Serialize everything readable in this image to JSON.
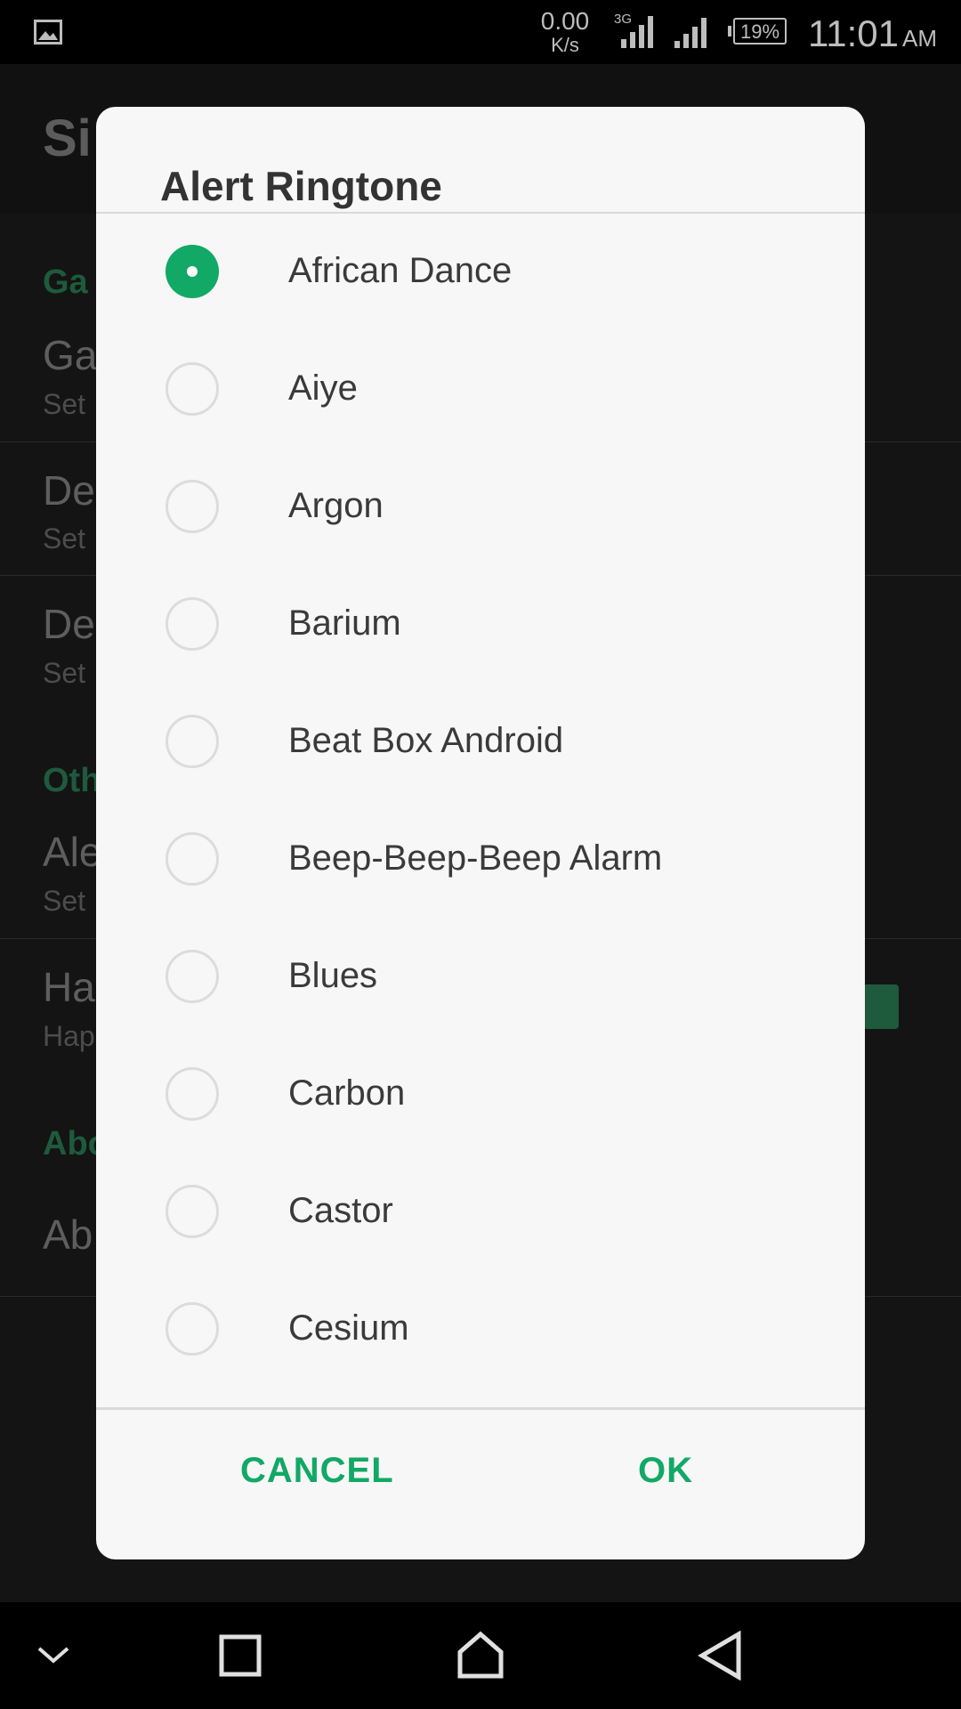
{
  "status_bar": {
    "net_speed_value": "0.00",
    "net_speed_unit": "K/s",
    "network_type": "3G",
    "battery": "19%",
    "time": "11:01",
    "ampm": "AM",
    "icons": [
      "gallery-icon",
      "signal-3g-icon",
      "signal-icon",
      "battery-icon"
    ]
  },
  "dialog": {
    "title": "Alert Ringtone",
    "options": [
      {
        "label": "African Dance",
        "selected": true
      },
      {
        "label": "Aiye",
        "selected": false
      },
      {
        "label": "Argon",
        "selected": false
      },
      {
        "label": "Barium",
        "selected": false
      },
      {
        "label": "Beat Box Android",
        "selected": false
      },
      {
        "label": "Beep-Beep-Beep Alarm",
        "selected": false
      },
      {
        "label": "Blues",
        "selected": false
      },
      {
        "label": "Carbon",
        "selected": false
      },
      {
        "label": "Castor",
        "selected": false
      },
      {
        "label": "Cesium",
        "selected": false
      }
    ],
    "cancel_label": "CANCEL",
    "ok_label": "OK"
  },
  "background": {
    "app_title": "Si",
    "rows": [
      {
        "kind": "section",
        "text": "Ga"
      },
      {
        "kind": "item",
        "text": "Ga"
      },
      {
        "kind": "sub",
        "text": "Set"
      },
      {
        "kind": "item",
        "text": "De"
      },
      {
        "kind": "sub",
        "text": "Set"
      },
      {
        "kind": "item",
        "text": "De"
      },
      {
        "kind": "sub",
        "text": "Set"
      },
      {
        "kind": "section",
        "text": "Oth"
      },
      {
        "kind": "item",
        "text": "Ale"
      },
      {
        "kind": "sub",
        "text": "Set"
      },
      {
        "kind": "item",
        "text": "Ha"
      },
      {
        "kind": "sub",
        "text": "Hap"
      },
      {
        "kind": "section",
        "text": "Abo"
      },
      {
        "kind": "item",
        "text": "Ab"
      }
    ]
  },
  "nav_bar": {
    "icons": [
      "chevron-down-icon",
      "recents-square-icon",
      "home-icon",
      "back-triangle-icon"
    ]
  },
  "colors": {
    "accent": "#12a866",
    "dialog_bg": "#f7f7f7",
    "scrim_bg": "#141414"
  }
}
